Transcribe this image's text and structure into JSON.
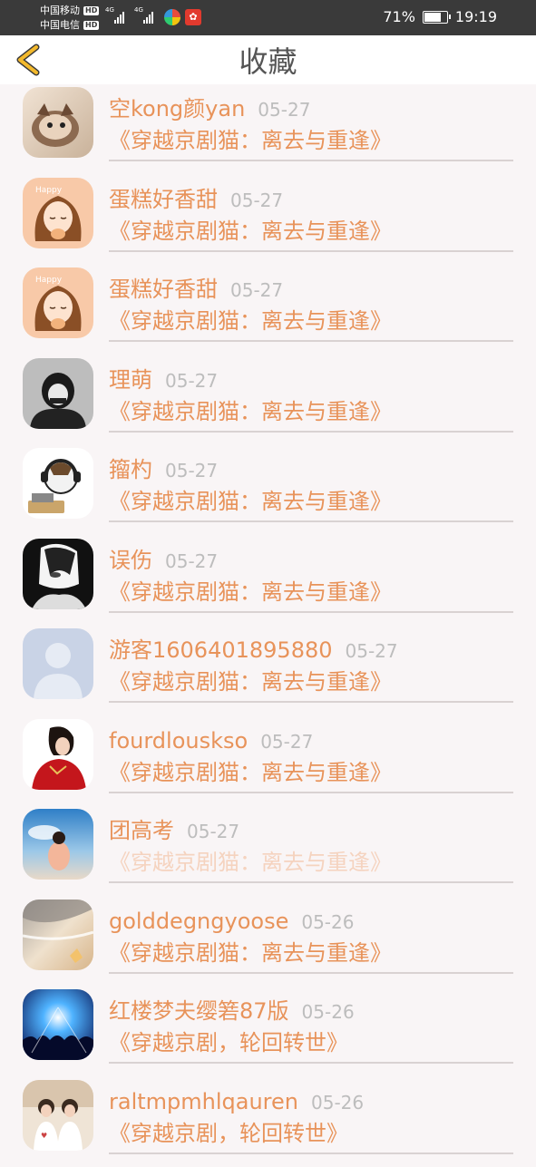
{
  "status_bar": {
    "carrier1": "中国移动",
    "carrier2": "中国电信",
    "hd_badge": "HD",
    "net1": "4G",
    "net2": "4G",
    "battery_pct": "71%",
    "battery_level": 0.71,
    "time": "19:19"
  },
  "header": {
    "title": "收藏",
    "back_icon": "chevron-left-icon",
    "accent": "#f3b92c"
  },
  "colors": {
    "name": "#e8935a",
    "date": "#bdbdbd",
    "background": "#f9f5f6"
  },
  "favorites": [
    {
      "name": "空kong颜yan",
      "date": "05-27",
      "book": "《穿越京剧猫：离去与重逢》",
      "avatar": "cat-photo"
    },
    {
      "name": "蛋糕好香甜",
      "date": "05-27",
      "book": "《穿越京剧猫：离去与重逢》",
      "avatar": "cartoon-girl"
    },
    {
      "name": "蛋糕好香甜",
      "date": "05-27",
      "book": "《穿越京剧猫：离去与重逢》",
      "avatar": "cartoon-girl"
    },
    {
      "name": "理萌",
      "date": "05-27",
      "book": "《穿越京剧猫：离去与重逢》",
      "avatar": "dark-anime-girl"
    },
    {
      "name": "籀杓",
      "date": "05-27",
      "book": "《穿越京剧猫：离去与重逢》",
      "avatar": "headphone-cartoon"
    },
    {
      "name": "误伤",
      "date": "05-27",
      "book": "《穿越京剧猫：离去与重逢》",
      "avatar": "monochrome-anime"
    },
    {
      "name": "游客1606401895880",
      "date": "05-27",
      "book": "《穿越京剧猫：离去与重逢》",
      "avatar": "default-user"
    },
    {
      "name": "fourdlouskso",
      "date": "05-27",
      "book": "《穿越京剧猫：离去与重逢》",
      "avatar": "red-dress-woman"
    },
    {
      "name": "团高考",
      "date": "05-27",
      "book": "《穿越京剧猫：离去与重逢》",
      "avatar": "sky-girl"
    },
    {
      "name": "golddegngyoose",
      "date": "05-26",
      "book": "《穿越京剧猫：离去与重逢》",
      "avatar": "beach-shell"
    },
    {
      "name": "红楼梦夫缨箬87版",
      "date": "05-26",
      "book": "《穿越京剧，轮回转世》",
      "avatar": "concert-crowd"
    },
    {
      "name": "raltmpmhlqauren",
      "date": "05-26",
      "book": "《穿越京剧，轮回转世》",
      "avatar": "couple-photo"
    }
  ]
}
